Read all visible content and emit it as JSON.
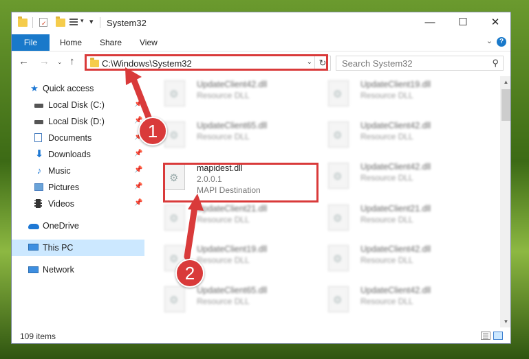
{
  "window": {
    "title": "System32",
    "caption": {
      "minimize": "—",
      "maximize": "☐",
      "close": "✕"
    }
  },
  "ribbon": {
    "tabs": [
      "File",
      "Home",
      "Share",
      "View"
    ],
    "help": "?"
  },
  "address": {
    "path": "C:\\Windows\\System32",
    "search_placeholder": "Search System32"
  },
  "nav_pane": {
    "items": [
      {
        "label": "Quick access",
        "icon": "star-icon"
      },
      {
        "label": "Local Disk (C:)",
        "icon": "drive-icon",
        "pinned": true
      },
      {
        "label": "Local Disk (D:)",
        "icon": "drive-icon",
        "pinned": true
      },
      {
        "label": "Documents",
        "icon": "documents-icon",
        "pinned": true
      },
      {
        "label": "Downloads",
        "icon": "download-icon",
        "pinned": true
      },
      {
        "label": "Music",
        "icon": "music-icon",
        "pinned": true
      },
      {
        "label": "Pictures",
        "icon": "pictures-icon",
        "pinned": true
      },
      {
        "label": "Videos",
        "icon": "videos-icon",
        "pinned": true
      },
      {
        "label": "OneDrive",
        "icon": "cloud-icon"
      },
      {
        "label": "This PC",
        "icon": "computer-icon",
        "selected": true
      },
      {
        "label": "Network",
        "icon": "network-icon"
      }
    ]
  },
  "files": {
    "left": [
      {
        "name": "UpdateClient42.dll",
        "type": "Resource DLL"
      },
      {
        "name": "UpdateClient65.dll",
        "type": "Resource DLL"
      },
      {
        "name": "mapidest.dll",
        "version": "2.0.0.1",
        "type": "MAPI Destination"
      },
      {
        "name": "UpdateClient21.dll",
        "type": "Resource DLL"
      },
      {
        "name": "UpdateClient19.dll",
        "type": "Resource DLL"
      },
      {
        "name": "UpdateClient65.dll",
        "type": "Resource DLL"
      }
    ],
    "right": [
      {
        "name": "UpdateClient19.dll",
        "type": "Resource DLL"
      },
      {
        "name": "UpdateClient42.dll",
        "type": "Resource DLL"
      },
      {
        "name": "UpdateClient42.dll",
        "type": "Resource DLL"
      },
      {
        "name": "UpdateClient21.dll",
        "type": "Resource DLL"
      },
      {
        "name": "UpdateClient42.dll",
        "type": "Resource DLL"
      },
      {
        "name": "UpdateClient42.dll",
        "type": "Resource DLL"
      }
    ]
  },
  "status": {
    "items": "109 items"
  },
  "annotations": {
    "step1": "1",
    "step2": "2",
    "color": "#d93a3a"
  }
}
